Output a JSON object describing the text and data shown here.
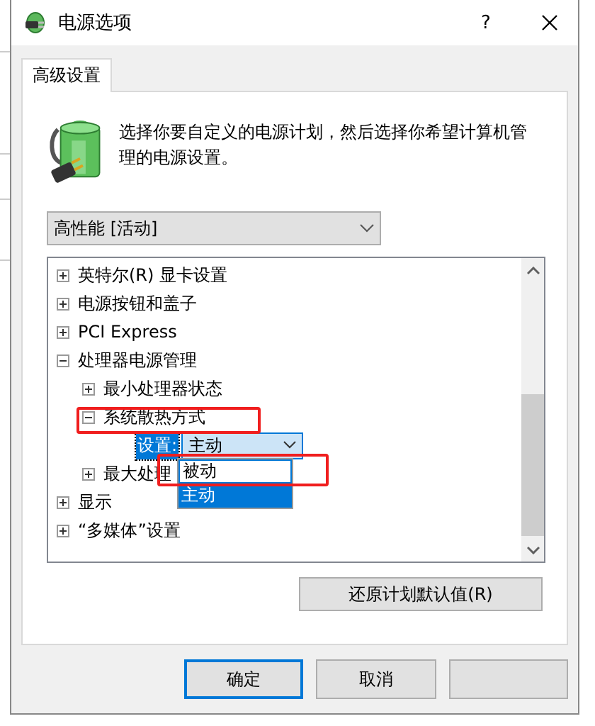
{
  "window": {
    "title": "电源选项",
    "help": "?"
  },
  "tabs": [
    {
      "label": "高级设置",
      "selected": true
    }
  ],
  "description": "选择你要自定义的电源计划，然后选择你希望计算机管理的电源设置。",
  "plan_select": {
    "value": "高性能 [活动]"
  },
  "tree": {
    "items": [
      {
        "label": "英特尔(R) 显卡设置",
        "expanded": false
      },
      {
        "label": "电源按钮和盖子",
        "expanded": false
      },
      {
        "label": "PCI Express",
        "expanded": false
      },
      {
        "label": "处理器电源管理",
        "expanded": true,
        "children": [
          {
            "label": "最小处理器状态",
            "expanded": false
          },
          {
            "label": "系统散热方式",
            "expanded": true,
            "setting": {
              "label": "设置:",
              "value": "主动",
              "open": true,
              "options": [
                {
                  "label": "被动",
                  "selected": false,
                  "focused": true
                },
                {
                  "label": "主动",
                  "selected": true,
                  "focused": false
                }
              ]
            }
          },
          {
            "label": "最大处理",
            "expanded": false
          }
        ]
      },
      {
        "label": "显示",
        "expanded": false
      },
      {
        "label": "“多媒体”设置",
        "expanded": false
      }
    ]
  },
  "restore_button": "还原计划默认值(R)",
  "buttons": [
    {
      "label": "确定",
      "default": true
    },
    {
      "label": "取消",
      "default": false
    },
    {
      "default": false
    }
  ]
}
